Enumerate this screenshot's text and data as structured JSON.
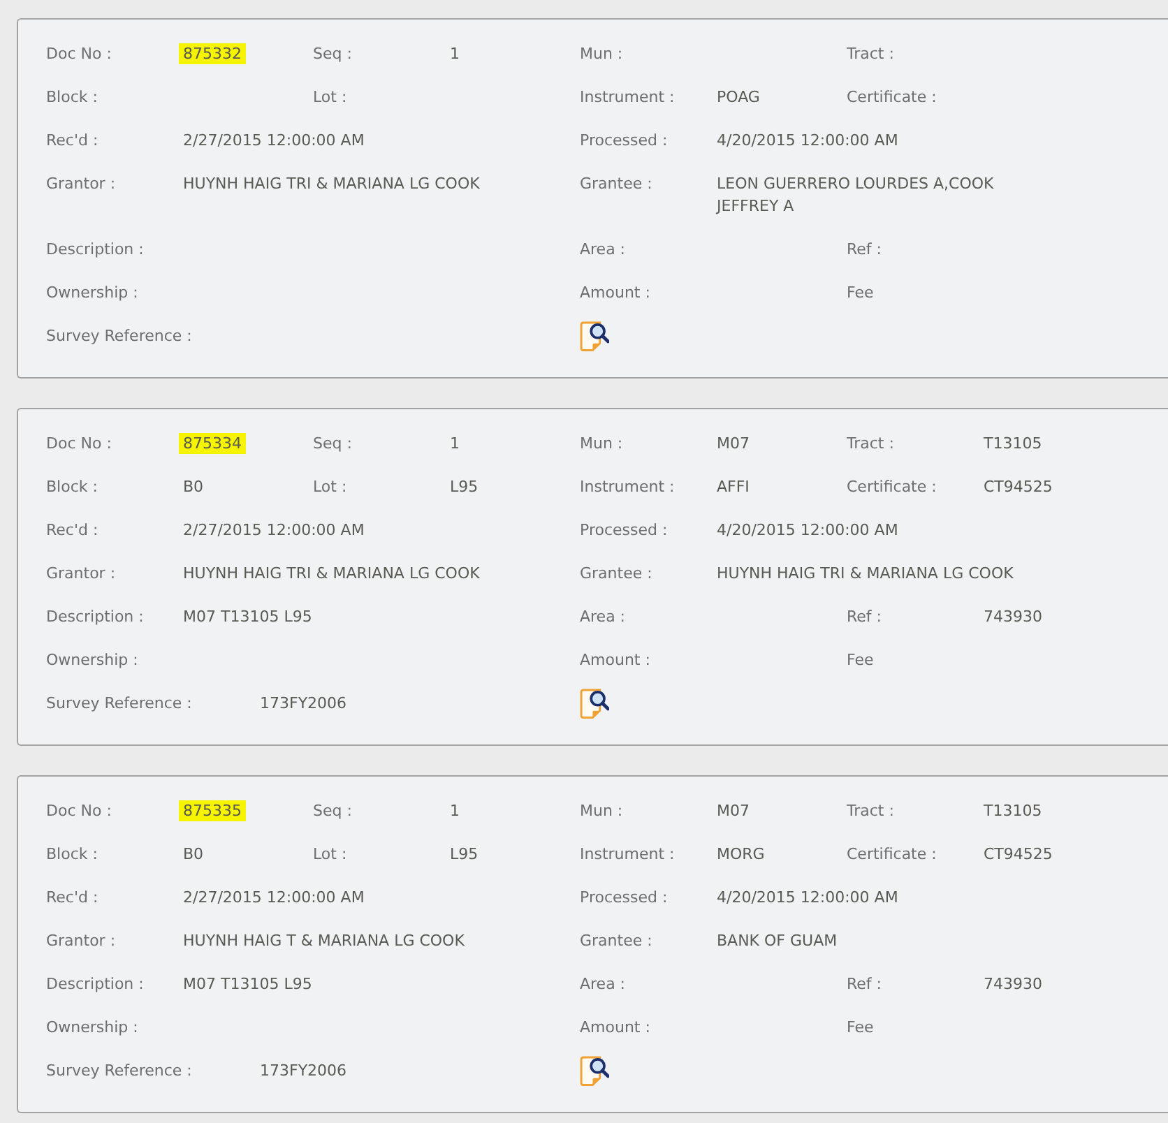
{
  "records": [
    {
      "doc_no": {
        "label": "Doc No :",
        "value": "875332",
        "highlighted": true
      },
      "seq": {
        "label": "Seq :",
        "value": "1"
      },
      "mun": {
        "label": "Mun :"
      },
      "tract": {
        "label": "Tract :"
      },
      "block": {
        "label": "Block :"
      },
      "lot": {
        "label": "Lot :"
      },
      "instrument": {
        "label": "Instrument :",
        "value": "POAG"
      },
      "certificate": {
        "label": "Certificate :"
      },
      "recd": {
        "label": "Rec'd :",
        "value": "2/27/2015 12:00:00 AM"
      },
      "processed": {
        "label": "Processed :",
        "value": "4/20/2015 12:00:00 AM"
      },
      "grantor": {
        "label": "Grantor :",
        "value": "HUYNH HAIG TRI & MARIANA LG COOK"
      },
      "grantee": {
        "label": "Grantee :",
        "value": "LEON GUERRERO LOURDES A,COOK JEFFREY A"
      },
      "description": {
        "label": "Description :"
      },
      "area": {
        "label": "Area :"
      },
      "ref": {
        "label": "Ref :"
      },
      "ownership": {
        "label": "Ownership :"
      },
      "amount": {
        "label": "Amount :"
      },
      "fee": {
        "label": "Fee"
      },
      "survey_reference": {
        "label": "Survey Reference :"
      }
    },
    {
      "doc_no": {
        "label": "Doc No :",
        "value": "875334",
        "highlighted": true
      },
      "seq": {
        "label": "Seq :",
        "value": "1"
      },
      "mun": {
        "label": "Mun :",
        "value": "M07"
      },
      "tract": {
        "label": "Tract :",
        "value": "T13105"
      },
      "block": {
        "label": "Block :",
        "value": "B0"
      },
      "lot": {
        "label": "Lot :",
        "value": "L95"
      },
      "instrument": {
        "label": "Instrument :",
        "value": "AFFI"
      },
      "certificate": {
        "label": "Certificate :",
        "value": "CT94525"
      },
      "recd": {
        "label": "Rec'd :",
        "value": "2/27/2015 12:00:00 AM"
      },
      "processed": {
        "label": "Processed :",
        "value": "4/20/2015 12:00:00 AM"
      },
      "grantor": {
        "label": "Grantor :",
        "value": "HUYNH HAIG TRI & MARIANA LG COOK"
      },
      "grantee": {
        "label": "Grantee :",
        "value": "HUYNH HAIG TRI & MARIANA LG COOK"
      },
      "description": {
        "label": "Description :",
        "value": "M07 T13105 L95"
      },
      "area": {
        "label": "Area :"
      },
      "ref": {
        "label": "Ref :",
        "value": "743930"
      },
      "ownership": {
        "label": "Ownership :"
      },
      "amount": {
        "label": "Amount :"
      },
      "fee": {
        "label": "Fee"
      },
      "survey_reference": {
        "label": "Survey Reference :",
        "value": "173FY2006"
      }
    },
    {
      "doc_no": {
        "label": "Doc No :",
        "value": "875335",
        "highlighted": true
      },
      "seq": {
        "label": "Seq :",
        "value": "1"
      },
      "mun": {
        "label": "Mun :",
        "value": "M07"
      },
      "tract": {
        "label": "Tract :",
        "value": "T13105"
      },
      "block": {
        "label": "Block :",
        "value": "B0"
      },
      "lot": {
        "label": "Lot :",
        "value": "L95"
      },
      "instrument": {
        "label": "Instrument :",
        "value": "MORG"
      },
      "certificate": {
        "label": "Certificate :",
        "value": "CT94525"
      },
      "recd": {
        "label": "Rec'd :",
        "value": "2/27/2015 12:00:00 AM"
      },
      "processed": {
        "label": "Processed :",
        "value": "4/20/2015 12:00:00 AM"
      },
      "grantor": {
        "label": "Grantor :",
        "value": "HUYNH HAIG T & MARIANA LG COOK"
      },
      "grantee": {
        "label": "Grantee :",
        "value": "BANK OF GUAM"
      },
      "description": {
        "label": "Description :",
        "value": "M07 T13105 L95"
      },
      "area": {
        "label": "Area :"
      },
      "ref": {
        "label": "Ref :",
        "value": "743930"
      },
      "ownership": {
        "label": "Ownership :"
      },
      "amount": {
        "label": "Amount :"
      },
      "fee": {
        "label": "Fee"
      },
      "survey_reference": {
        "label": "Survey Reference :",
        "value": "173FY2006"
      }
    }
  ]
}
